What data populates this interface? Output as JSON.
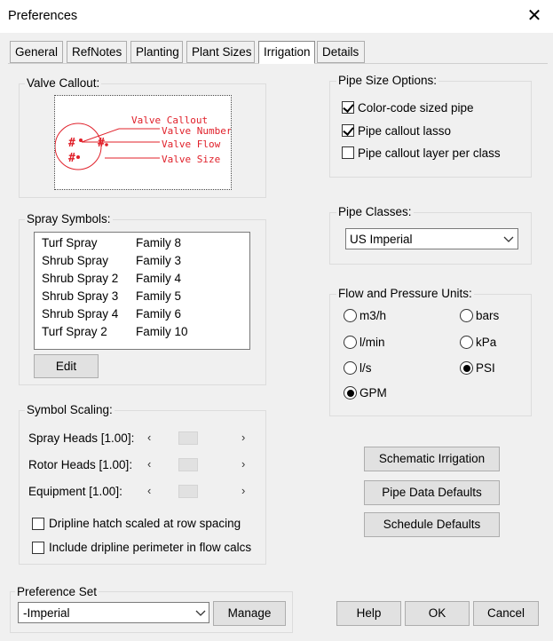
{
  "window": {
    "title": "Preferences"
  },
  "tabs": [
    {
      "label": "General",
      "active": false
    },
    {
      "label": "RefNotes",
      "active": false
    },
    {
      "label": "Planting",
      "active": false
    },
    {
      "label": "Plant Sizes",
      "active": false
    },
    {
      "label": "Irrigation",
      "active": true
    },
    {
      "label": "Details",
      "active": false
    }
  ],
  "valve_callout": {
    "label": "Valve Callout:",
    "preview": {
      "callout": "Valve Callout",
      "number": "Valve Number",
      "flow": "Valve Flow",
      "size": "Valve Size",
      "color": "#e0202a"
    }
  },
  "spray_symbols": {
    "label": "Spray Symbols:",
    "items": [
      {
        "name": "Turf Spray",
        "family": "Family 8"
      },
      {
        "name": "Shrub Spray",
        "family": "Family 3"
      },
      {
        "name": "Shrub Spray 2",
        "family": "Family 4"
      },
      {
        "name": "Shrub Spray 3",
        "family": "Family 5"
      },
      {
        "name": "Shrub Spray 4",
        "family": "Family 6"
      },
      {
        "name": "Turf Spray 2",
        "family": "Family 10"
      }
    ],
    "edit_label": "Edit"
  },
  "symbol_scaling": {
    "label": "Symbol Scaling:",
    "rows": [
      {
        "label": "Spray Heads [1.00]:",
        "value": 1.0
      },
      {
        "label": "Rotor Heads [1.00]:",
        "value": 1.0
      },
      {
        "label": "Equipment [1.00]:",
        "value": 1.0
      }
    ],
    "dripline_hatch": {
      "label": "Dripline hatch scaled at row spacing",
      "checked": false
    },
    "dripline_perimeter": {
      "label": "Include dripline perimeter in flow calcs",
      "checked": false
    }
  },
  "pipe_size_options": {
    "label": "Pipe Size Options:",
    "options": [
      {
        "label": "Color-code sized pipe",
        "checked": true
      },
      {
        "label": "Pipe callout lasso",
        "checked": true
      },
      {
        "label": "Pipe callout layer per class",
        "checked": false
      }
    ]
  },
  "pipe_classes": {
    "label": "Pipe Classes:",
    "selected": "US Imperial"
  },
  "flow_units": {
    "label": "Flow and Pressure Units:",
    "flow": [
      {
        "label": "m3/h",
        "selected": false
      },
      {
        "label": "l/min",
        "selected": false
      },
      {
        "label": "l/s",
        "selected": false
      },
      {
        "label": "GPM",
        "selected": true
      }
    ],
    "pressure": [
      {
        "label": "bars",
        "selected": false
      },
      {
        "label": "kPa",
        "selected": false
      },
      {
        "label": "PSI",
        "selected": true
      }
    ]
  },
  "buttons": {
    "schematic": "Schematic Irrigation",
    "pipe_data": "Pipe Data Defaults",
    "schedule": "Schedule Defaults",
    "help": "Help",
    "ok": "OK",
    "cancel": "Cancel"
  },
  "preference_set": {
    "label": "Preference Set",
    "selected": "-Imperial",
    "manage_label": "Manage"
  }
}
